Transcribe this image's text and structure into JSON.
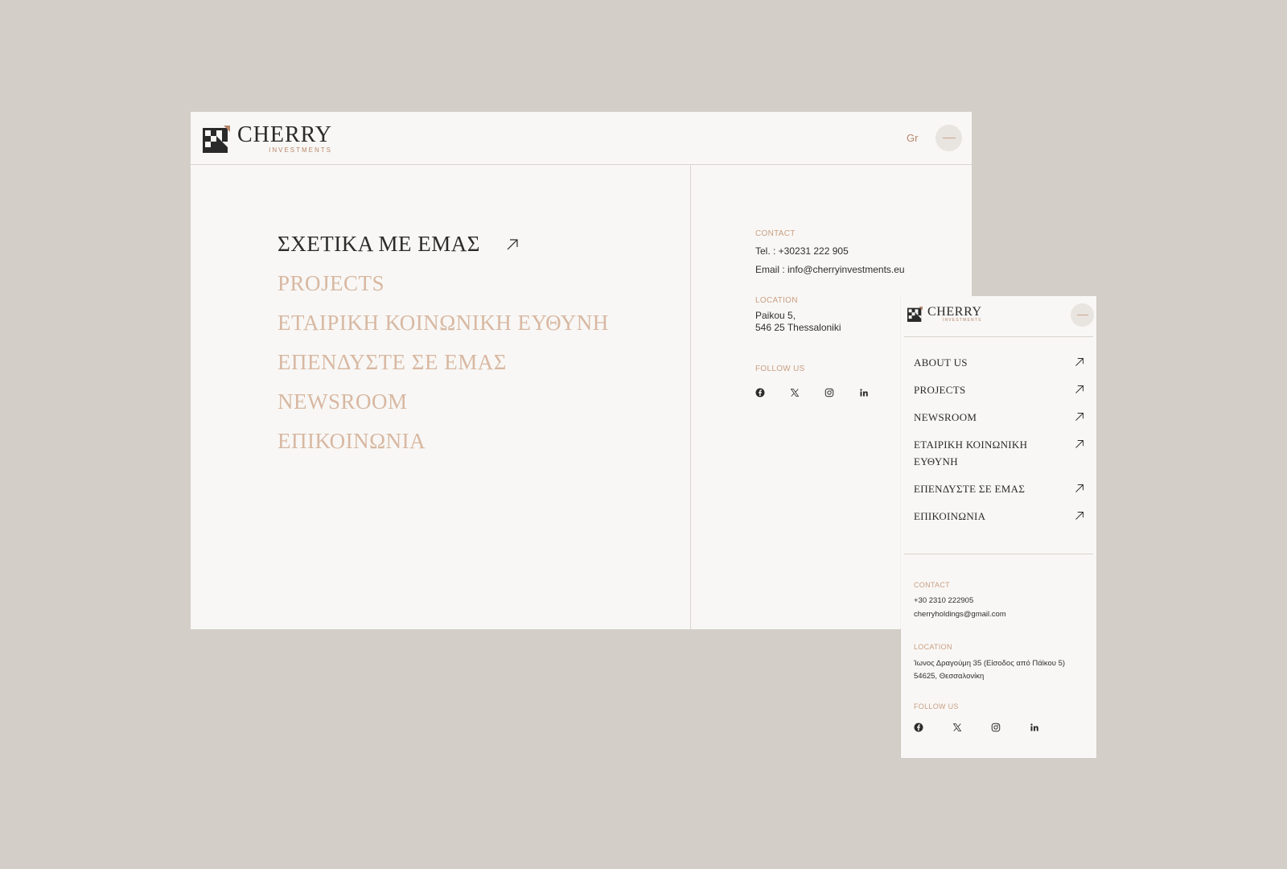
{
  "brand": {
    "name": "CHERRY",
    "tagline": "INVESTMENTS"
  },
  "colors": {
    "background": "#d3cec7",
    "panel": "#f8f7f5",
    "accent": "#b8866a",
    "muted_nav": "#d8b8a2",
    "text": "#2b2b2b"
  },
  "desktop": {
    "header": {
      "lang_label": "Gr",
      "menu_icon": "close-menu-icon"
    },
    "nav": [
      {
        "label": "ΣΧΕΤΙΚΑ ΜΕ ΕΜΑΣ",
        "active": true
      },
      {
        "label": "PROJECTS",
        "active": false
      },
      {
        "label": "ΕΤΑΙΡΙΚΗ ΚΟΙΝΩΝΙΚΗ ΕΥΘΥΝΗ",
        "active": false
      },
      {
        "label": "ΕΠΕΝΔΥΣΤΕ ΣΕ ΕΜΑΣ",
        "active": false
      },
      {
        "label": "NEWSROOM",
        "active": false
      },
      {
        "label": "ΕΠΙΚΟΙΝΩΝΙΑ",
        "active": false
      }
    ],
    "contact": {
      "label": "CONTACT",
      "tel": "Tel. : +30231 222 905",
      "email": "Email : info@cherryinvestments.eu"
    },
    "location": {
      "label": "LOCATION",
      "line1": "Paikou 5,",
      "line2": "546 25 Thessaloniki"
    },
    "follow": {
      "label": "FOLLOW US",
      "icons": [
        "facebook-icon",
        "x-icon",
        "instagram-icon",
        "linkedin-icon"
      ]
    }
  },
  "mobile": {
    "nav": [
      {
        "label": "ABOUT US"
      },
      {
        "label": "PROJECTS"
      },
      {
        "label": "NEWSROOM"
      },
      {
        "label": "ΕΤΑΙΡΙΚΗ ΚΟΙΝΩΝΙΚΗ ΕΥΘΥΝΗ"
      },
      {
        "label": "ΕΠΕΝΔΥΣΤΕ ΣΕ ΕΜΑΣ"
      },
      {
        "label": "ΕΠΙΚΟΙΝΩΝΙΑ"
      }
    ],
    "contact": {
      "label": "CONTACT",
      "tel": "+30 2310 222905",
      "email": "cherryholdings@gmail.com"
    },
    "location": {
      "label": "LOCATION",
      "line1": "Ίωνος Δραγούμη 35 (Είσοδος από Πάϊκου 5)",
      "line2": "54625, Θεσσαλονίκη"
    },
    "follow": {
      "label": "FOLLOW US"
    }
  }
}
